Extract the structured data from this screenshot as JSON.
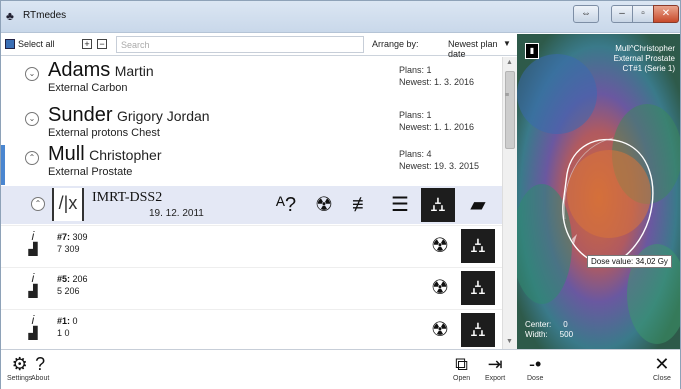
{
  "window": {
    "title": "RTmedes",
    "app_icon": "rtmedes-icon"
  },
  "toolbar": {
    "select_all": "Select all",
    "expand_all": "+",
    "collapse_all": "−",
    "search_placeholder": "Search",
    "arrange_label": "Arrange by:",
    "arrange_value": "Newest plan date"
  },
  "patients": [
    {
      "last": "Adams",
      "first": "Martin",
      "desc": "External Carbon",
      "plans": "Plans: 1",
      "newest": "Newest: 1. 3. 2016"
    },
    {
      "last": "Sunder",
      "first": "Grigory Jordan",
      "desc": "External protons Chest",
      "plans": "Plans: 1",
      "newest": "Newest: 1. 1. 2016"
    },
    {
      "last": "Mull",
      "first": "Christopher",
      "desc": "External Prostate",
      "plans": "Plans: 4",
      "newest": "Newest: 19. 3. 2015"
    }
  ],
  "plan": {
    "name": "IMRT-DSS2",
    "date": "19. 12. 2011",
    "actions": [
      "question-icon",
      "radiation-icon",
      "edit-lines-icon",
      "lines-icon",
      "dose-icon",
      "folder-icon"
    ]
  },
  "subplans": [
    {
      "id": "#7:",
      "id_val": "309",
      "val": "7 309"
    },
    {
      "id": "#5:",
      "id_val": "206",
      "val": "5 206"
    },
    {
      "id": "#1:",
      "id_val": "0",
      "val": "1 0"
    }
  ],
  "bottom": {
    "settings": "Settings",
    "about": "About",
    "open": "Open",
    "export": "Export",
    "dose": "Dose",
    "close": "Close"
  },
  "viewer": {
    "patient": "Mull^Christopher",
    "plan": "External Prostate",
    "series": "CT#1 (Serie 1)",
    "tooltip": "Dose value: 34,02 Gy",
    "center_label": "Center:",
    "center_value": "0",
    "width_label": "Width:",
    "width_value": "500"
  },
  "colors": {
    "accent": "#4a86d0",
    "plan_row_bg": "#e4e8f5",
    "close_button": "#c84a2b"
  }
}
